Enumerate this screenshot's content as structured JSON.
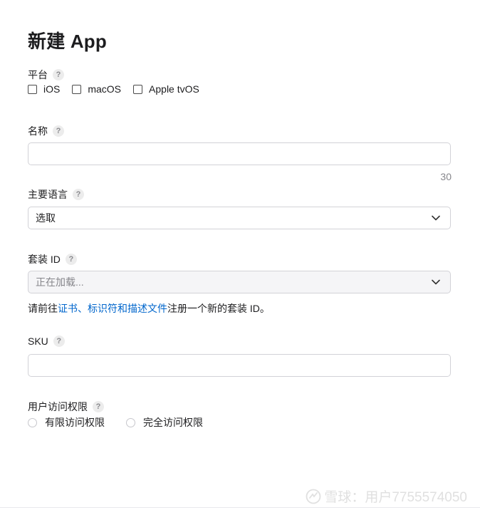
{
  "page": {
    "title": "新建 App"
  },
  "help_glyph": "?",
  "platform": {
    "label": "平台",
    "options": [
      "iOS",
      "macOS",
      "Apple tvOS"
    ]
  },
  "name_field": {
    "label": "名称",
    "value": "",
    "char_counter": "30"
  },
  "primary_language": {
    "label": "主要语言",
    "selected": "选取"
  },
  "bundle_id": {
    "label": "套装 ID",
    "selected": "正在加载...",
    "note_prefix": "请前往",
    "note_link": "证书、标识符和描述文件",
    "note_suffix": "注册一个新的套装 ID。"
  },
  "sku": {
    "label": "SKU",
    "value": ""
  },
  "user_access": {
    "label": "用户访问权限",
    "options": [
      "有限访问权限",
      "完全访问权限"
    ]
  },
  "watermark": {
    "text": "雪球：用户7755574050"
  },
  "colors": {
    "link": "#0066cc",
    "border": "#d2d2d7",
    "muted": "#86868b"
  }
}
